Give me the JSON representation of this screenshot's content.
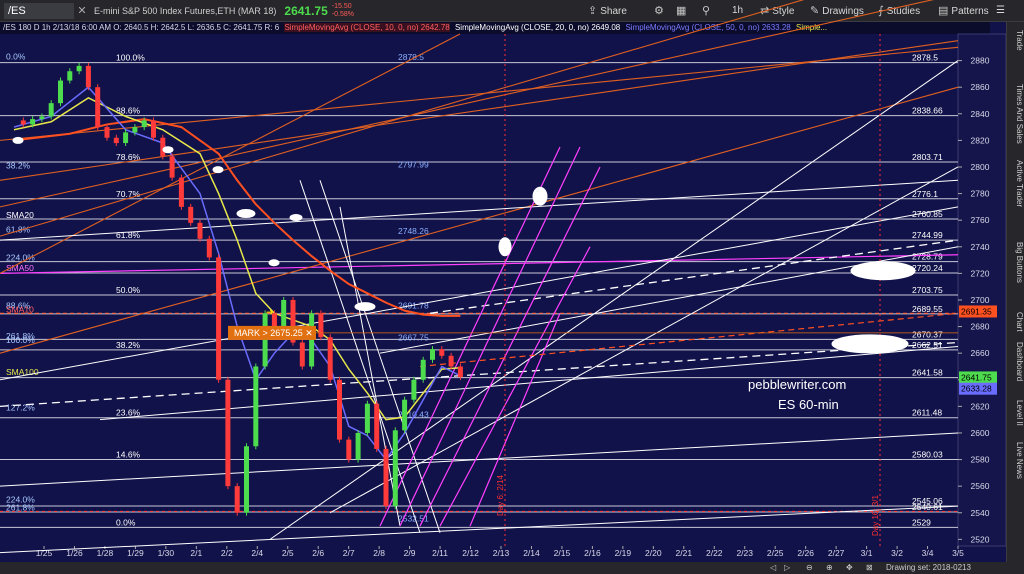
{
  "toolbar": {
    "symbol": "/ES",
    "title": "E-mini S&P 500 Index Futures,ETH (MAR 18)",
    "last": "2641.75",
    "change": "-15.50",
    "change_pct": "-0.58%",
    "share": "Share",
    "period": "1h",
    "style": "Style",
    "drawings": "Drawings",
    "studies": "Studies",
    "patterns": "Patterns"
  },
  "subbar": {
    "ohlc": "/ES 180 D 1h  2/13/18 6:00 AM  O: 2640.5  H: 2642.5  L: 2636.5  C: 2641.75  R: 6",
    "sma10": "SimpleMovingAvg (CLOSE, 10, 0, no)  2642.78",
    "sma20": "SimpleMovingAvg (CLOSE, 20, 0, no)  2649.08",
    "sma50": "SimpleMovingAvg (CLOSE, 50, 0, no)  2633.28",
    "sma100": "Simple..."
  },
  "sidebar_tabs": [
    "Trade",
    "Times And Sales",
    "Active Trader",
    "Big Buttons",
    "Chart",
    "Dashboard",
    "Level II",
    "Live News"
  ],
  "status": "Drawing set: 2018-0213",
  "colors": {
    "background": "#12124a",
    "price_up": "#4ddc4d",
    "price_down": "#ff3a3a",
    "sma10": "#6a6cff",
    "sma20": "#e8e84a",
    "sma50": "#ff5020",
    "fib": "#e8e8e8",
    "channel": "#ff40ff",
    "mark": "#e07010"
  },
  "chart_data": {
    "type": "line",
    "ylim": [
      2515,
      2900
    ],
    "y_ticks": [
      2520,
      2540,
      2560,
      2580,
      2600,
      2620,
      2640,
      2660,
      2680,
      2700,
      2720,
      2740,
      2760,
      2780,
      2800,
      2820,
      2840,
      2860,
      2880
    ],
    "x_labels": [
      "1/25",
      "1/26",
      "1/28",
      "1/29",
      "1/30",
      "2/1",
      "2/2",
      "2/4",
      "2/5",
      "2/6",
      "2/7",
      "2/8",
      "2/9",
      "2/11",
      "2/12",
      "2/13",
      "2/14",
      "2/15",
      "2/16",
      "2/19",
      "2/20",
      "2/21",
      "2/22",
      "2/23",
      "2/25",
      "2/26",
      "2/27",
      "3/1",
      "3/2",
      "3/4",
      "3/5"
    ],
    "watermark": [
      "pebblewriter.com",
      "ES 60-min"
    ],
    "fib_levels": [
      {
        "pct": "100.0%",
        "value": 2878.5
      },
      {
        "pct": "88.6%",
        "value": 2838.66
      },
      {
        "pct": "78.6%",
        "value": 2803.71
      },
      {
        "pct": "70.7%",
        "value": 2776.1
      },
      {
        "pct": "61.8%",
        "value": 2744.99
      },
      {
        "pct": "50.0%",
        "value": 2703.75
      },
      {
        "pct": "38.2%",
        "value": 2662.51
      },
      {
        "pct": "23.6%",
        "value": 2611.48
      },
      {
        "pct": "14.6%",
        "value": 2580.03
      },
      {
        "pct": "0.0%",
        "value": 2529
      }
    ],
    "left_labels": [
      {
        "text": "0.0%",
        "value": 2880
      },
      {
        "text": "38.2%",
        "value": 2798
      },
      {
        "text": "SMA20",
        "value": 2761
      },
      {
        "text": "61.8%",
        "value": 2750
      },
      {
        "text": "224.0%",
        "value": 2729
      },
      {
        "text": "SMA50",
        "value": 2721
      },
      {
        "text": "88.6%",
        "value": 2693
      },
      {
        "text": "SMA10",
        "value": 2690
      },
      {
        "text": "261.8%",
        "value": 2670
      },
      {
        "text": "100.0%",
        "value": 2667
      },
      {
        "text": "SMA100",
        "value": 2643
      },
      {
        "text": "127.2%",
        "value": 2616
      },
      {
        "text": "224.0%",
        "value": 2547
      },
      {
        "text": "261.8%",
        "value": 2541
      }
    ],
    "mid_labels": [
      {
        "text": "2878.5",
        "value": 2879
      },
      {
        "text": "2797.99",
        "value": 2798
      },
      {
        "text": "2748.26",
        "value": 2748
      },
      {
        "text": "2691.78",
        "value": 2692
      },
      {
        "text": "2667.75",
        "value": 2668
      },
      {
        "text": "2610.43",
        "value": 2610
      },
      {
        "text": "2532.51",
        "value": 2532
      }
    ],
    "right_levels": [
      {
        "text": "2878.5",
        "value": 2878.5
      },
      {
        "text": "2838.66",
        "value": 2838.66
      },
      {
        "text": "2803.71",
        "value": 2803.71
      },
      {
        "text": "2776.1",
        "value": 2776.1
      },
      {
        "text": "2760.85",
        "value": 2760.85
      },
      {
        "text": "2744.99",
        "value": 2744.99
      },
      {
        "text": "2728.79",
        "value": 2728.79
      },
      {
        "text": "2720.24",
        "value": 2720.24
      },
      {
        "text": "2703.75",
        "value": 2703.75
      },
      {
        "text": "2689.55",
        "value": 2689.55
      },
      {
        "text": "2670.37",
        "value": 2670.37
      },
      {
        "text": "2662.51",
        "value": 2662.51
      },
      {
        "text": "2641.58",
        "value": 2641.58
      },
      {
        "text": "2611.48",
        "value": 2611.48
      },
      {
        "text": "2580.03",
        "value": 2580.03
      },
      {
        "text": "2545.06",
        "value": 2545.06
      },
      {
        "text": "2540.61",
        "value": 2540.61
      },
      {
        "text": "2529",
        "value": 2529
      }
    ],
    "price_tags": [
      {
        "text": "2691.35",
        "value": 2691.35,
        "color": "#ff5020"
      },
      {
        "text": "2641.75",
        "value": 2641.75,
        "color": "#4ddc4d"
      },
      {
        "text": "2633.28",
        "value": 2633.28,
        "color": "#6a6cff"
      }
    ],
    "mark_label": "MARK > 2675.25",
    "mark_value": 2675.25,
    "day_labels": [
      "Day 6: 2/14",
      "Day 16: 3/1"
    ],
    "price_path": [
      [
        0,
        2835
      ],
      [
        1,
        2832
      ],
      [
        2,
        2836
      ],
      [
        3,
        2838
      ],
      [
        4,
        2848
      ],
      [
        5,
        2865
      ],
      [
        6,
        2872
      ],
      [
        7,
        2876
      ],
      [
        8,
        2860
      ],
      [
        9,
        2830
      ],
      [
        10,
        2822
      ],
      [
        11,
        2818
      ],
      [
        12,
        2826
      ],
      [
        13,
        2830
      ],
      [
        14,
        2835
      ],
      [
        15,
        2822
      ],
      [
        16,
        2808
      ],
      [
        17,
        2792
      ],
      [
        18,
        2770
      ],
      [
        19,
        2758
      ],
      [
        20,
        2746
      ],
      [
        21,
        2732
      ],
      [
        22,
        2640
      ],
      [
        23,
        2560
      ],
      [
        24,
        2540
      ],
      [
        25,
        2590
      ],
      [
        26,
        2650
      ],
      [
        27,
        2690
      ],
      [
        28,
        2680
      ],
      [
        29,
        2700
      ],
      [
        30,
        2668
      ],
      [
        31,
        2650
      ],
      [
        32,
        2690
      ],
      [
        33,
        2672
      ],
      [
        34,
        2640
      ],
      [
        35,
        2595
      ],
      [
        36,
        2580
      ],
      [
        37,
        2600
      ],
      [
        38,
        2622
      ],
      [
        39,
        2588
      ],
      [
        40,
        2545
      ],
      [
        41,
        2602
      ],
      [
        42,
        2625
      ],
      [
        43,
        2640
      ],
      [
        44,
        2655
      ],
      [
        45,
        2663
      ],
      [
        46,
        2658
      ],
      [
        47,
        2650
      ],
      [
        48,
        2642
      ]
    ],
    "sma10": [
      [
        0,
        2830
      ],
      [
        4,
        2838
      ],
      [
        8,
        2860
      ],
      [
        12,
        2828
      ],
      [
        16,
        2818
      ],
      [
        20,
        2780
      ],
      [
        22,
        2735
      ],
      [
        24,
        2680
      ],
      [
        26,
        2640
      ],
      [
        28,
        2660
      ],
      [
        30,
        2675
      ],
      [
        32,
        2670
      ],
      [
        34,
        2650
      ],
      [
        36,
        2605
      ],
      [
        38,
        2598
      ],
      [
        40,
        2580
      ],
      [
        42,
        2600
      ],
      [
        44,
        2625
      ],
      [
        46,
        2650
      ],
      [
        48,
        2643
      ]
    ],
    "sma20": [
      [
        0,
        2828
      ],
      [
        4,
        2834
      ],
      [
        8,
        2852
      ],
      [
        12,
        2838
      ],
      [
        16,
        2828
      ],
      [
        20,
        2810
      ],
      [
        22,
        2780
      ],
      [
        24,
        2745
      ],
      [
        26,
        2705
      ],
      [
        28,
        2690
      ],
      [
        30,
        2685
      ],
      [
        32,
        2680
      ],
      [
        34,
        2670
      ],
      [
        36,
        2648
      ],
      [
        38,
        2630
      ],
      [
        40,
        2610
      ],
      [
        42,
        2612
      ],
      [
        44,
        2630
      ],
      [
        46,
        2648
      ],
      [
        48,
        2649
      ]
    ],
    "sma50": [
      [
        0,
        2820
      ],
      [
        6,
        2825
      ],
      [
        10,
        2832
      ],
      [
        14,
        2836
      ],
      [
        18,
        2830
      ],
      [
        22,
        2810
      ],
      [
        24,
        2790
      ],
      [
        26,
        2772
      ],
      [
        28,
        2758
      ],
      [
        30,
        2745
      ],
      [
        32,
        2733
      ],
      [
        34,
        2722
      ],
      [
        36,
        2712
      ],
      [
        38,
        2705
      ],
      [
        40,
        2698
      ],
      [
        42,
        2692
      ],
      [
        44,
        2689
      ],
      [
        46,
        2688
      ],
      [
        48,
        2688
      ]
    ]
  }
}
